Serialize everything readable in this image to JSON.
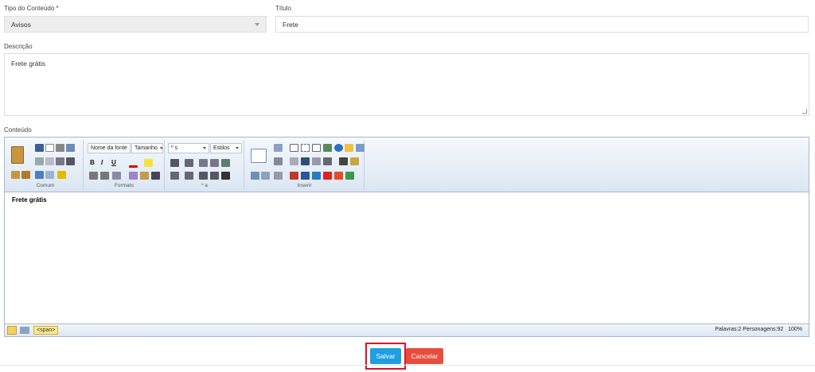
{
  "form": {
    "tipo_label": "Tipo do Conteúdo *",
    "tipo_value": "Avisos",
    "titulo_label": "Título",
    "titulo_value": "Frete",
    "descricao_label": "Descrição",
    "descricao_value": "Frete grátis",
    "conteudo_label": "Conteúdo"
  },
  "editor": {
    "font_name": "Nome da fonte",
    "font_size": "Tamanho",
    "format": "º s",
    "styles": "Estilos",
    "group_labels": [
      "Comum",
      "Formato",
      "º a",
      "Inserir"
    ],
    "bold": "B",
    "italic": "I",
    "underline": "U",
    "content": "Frete grátis",
    "tag_path": "<span>",
    "words_chars": "Palavras:2 Personagens:92",
    "zoom": "100%"
  },
  "actions": {
    "save_label": "Salvar",
    "cancel_label": "Cancelar"
  },
  "colors": {
    "save": "#1e9fe0",
    "cancel": "#e84c3d",
    "highlight": "#e0102a"
  }
}
